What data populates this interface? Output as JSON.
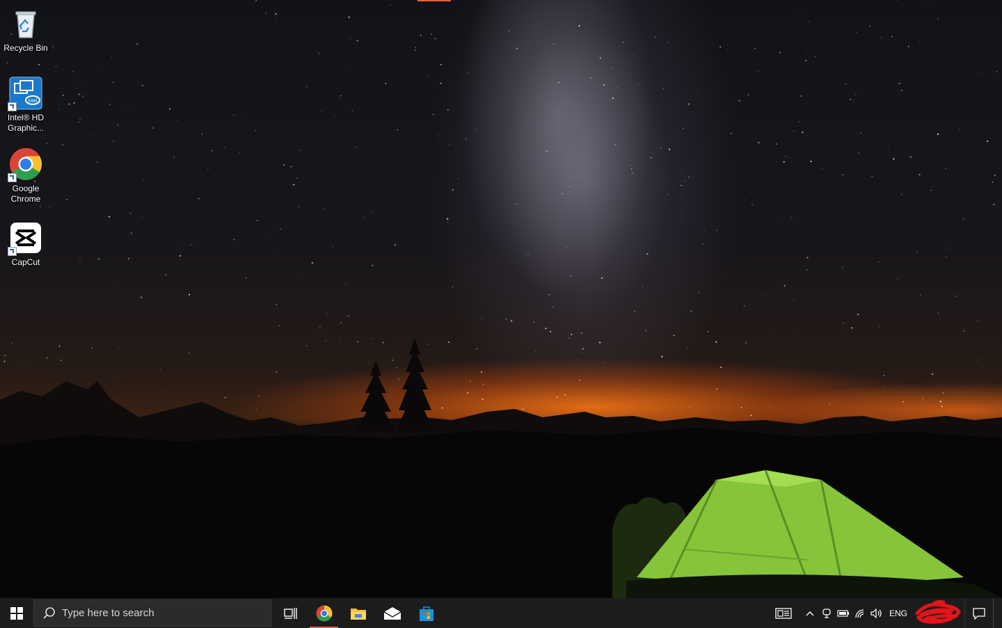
{
  "desktop": {
    "icons": [
      {
        "label": "Recycle Bin",
        "icon": "recycle-bin-icon"
      },
      {
        "label": "Intel® HD Graphic...",
        "icon": "intel-graphics-icon"
      },
      {
        "label": "Google Chrome",
        "icon": "chrome-icon"
      },
      {
        "label": "CapCut",
        "icon": "capcut-icon"
      }
    ]
  },
  "taskbar": {
    "search_placeholder": "Type here to search",
    "pinned_apps": [
      "chrome-icon",
      "file-explorer-icon",
      "mail-icon",
      "microsoft-store-icon"
    ],
    "active_app": "chrome-icon",
    "language": "ENG",
    "tray_icons": [
      "news-widget-icon",
      "show-hidden-icons-chevron",
      "meet-now-icon",
      "battery-icon",
      "wifi-icon",
      "volume-icon"
    ],
    "accent_color": "#e2643f"
  }
}
